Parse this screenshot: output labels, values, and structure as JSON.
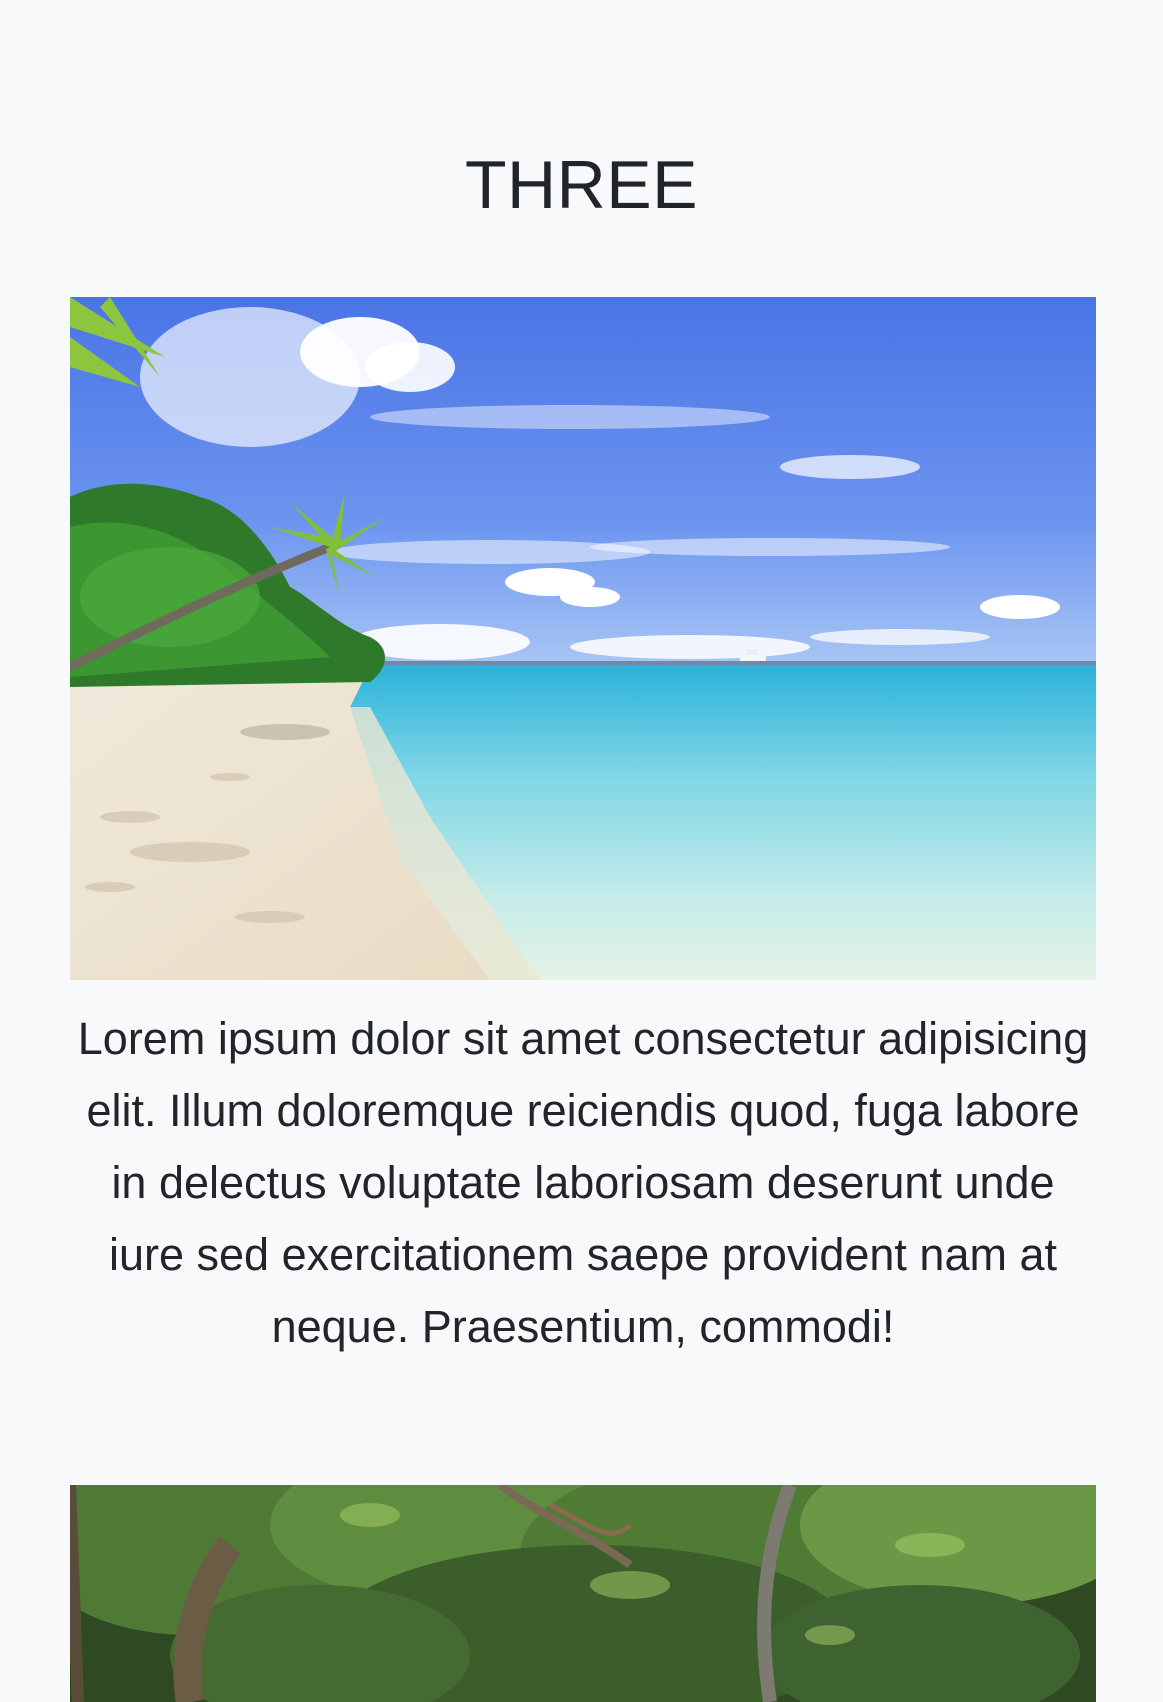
{
  "section": {
    "title": "THREE",
    "caption": "Lorem ipsum dolor sit amet consectetur adipisicing elit. Illum doloremque reiciendis quod, fuga labore in delectus voluptate laboriosam deserunt unde iure sed exercitationem saepe provident nam at neque. Praesentium, commodi!"
  },
  "images": {
    "beach": {
      "subject": "tropical-beach-photo"
    },
    "forest": {
      "subject": "forest-canopy-photo"
    }
  },
  "colors": {
    "background": "#f8f9fa",
    "text": "#212529"
  }
}
